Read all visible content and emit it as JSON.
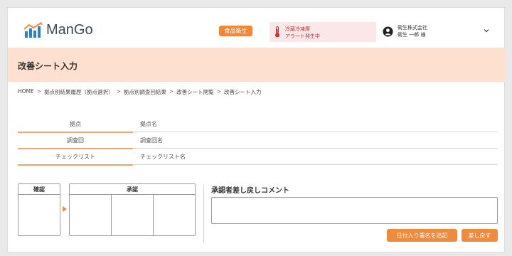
{
  "header": {
    "logo_text": "ManGo",
    "tag": "食品衛生",
    "alert": {
      "line1": "冷蔵冷凍庫",
      "line2": "アラート発生中"
    },
    "user": {
      "company": "衛生株式会社",
      "name": "衛生 一郎 様"
    }
  },
  "page": {
    "title": "改善シート入力"
  },
  "breadcrumb": [
    "HOME",
    "拠点別結果履歴（拠点選択）",
    "拠点別調査回結果",
    "改善シート閲覧",
    "改善シート入力"
  ],
  "info_rows": [
    {
      "label": "拠点",
      "value": "拠点名"
    },
    {
      "label": "調査回",
      "value": "調査回名"
    },
    {
      "label": "チェックリスト",
      "value": "チェックリスト名"
    }
  ],
  "approval": {
    "confirm_label": "確認",
    "approve_label": "承認"
  },
  "comment": {
    "label": "承認者差し戻しコメント",
    "value": ""
  },
  "buttons": {
    "add_signature": "日付入り署名を追記",
    "send_back": "差し戻す"
  },
  "colors": {
    "accent": "#f08a3c",
    "title_bg": "#fde0cf",
    "alert_bg": "#fbe7e7"
  }
}
